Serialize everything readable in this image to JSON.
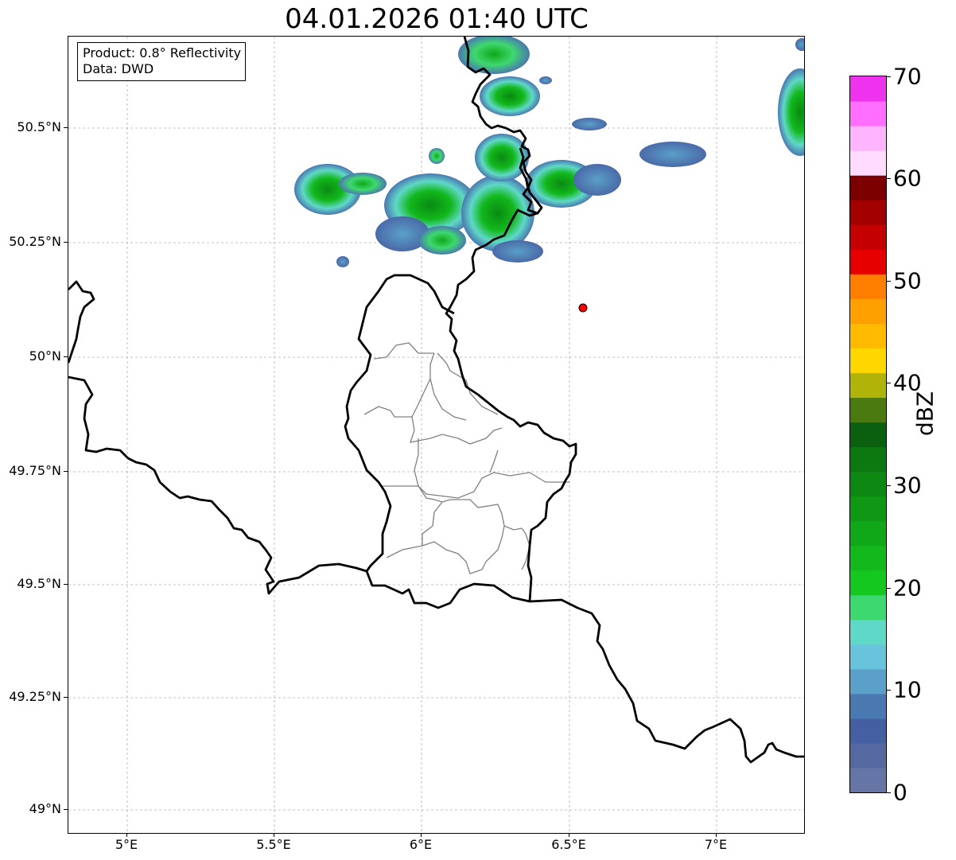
{
  "title": "04.01.2026 01:40 UTC",
  "info": {
    "product": "Product: 0.8° Reflectivity",
    "data": "Data: DWD"
  },
  "map": {
    "lon_range": [
      4.8,
      7.3
    ],
    "lat_range": [
      48.95,
      50.695
    ],
    "lon_ticks": [
      {
        "v": 5.0,
        "label": "5°E"
      },
      {
        "v": 5.5,
        "label": "5.5°E"
      },
      {
        "v": 6.0,
        "label": "6°E"
      },
      {
        "v": 6.5,
        "label": "6.5°E"
      },
      {
        "v": 7.0,
        "label": "7°E"
      }
    ],
    "lat_ticks": [
      {
        "v": 49.0,
        "label": "49°N"
      },
      {
        "v": 49.25,
        "label": "49.25°N"
      },
      {
        "v": 49.5,
        "label": "49.5°N"
      },
      {
        "v": 49.75,
        "label": "49.75°N"
      },
      {
        "v": 50.0,
        "label": "50°N"
      },
      {
        "v": 50.25,
        "label": "50.25°N"
      },
      {
        "v": 50.5,
        "label": "50.5°N"
      }
    ],
    "gridlines": true,
    "radar_site": {
      "lon": 6.548,
      "lat": 50.11,
      "color": "#ff0000"
    }
  },
  "colorbar": {
    "label": "dBZ",
    "min": 0,
    "max": 70,
    "tick_labels": [
      "0",
      "10",
      "20",
      "30",
      "40",
      "50",
      "60",
      "70"
    ],
    "colors": [
      "#6575a6",
      "#5569a0",
      "#4460a2",
      "#4a78b0",
      "#5aa0c8",
      "#68c4dd",
      "#60d8c8",
      "#3ed870",
      "#14c820",
      "#12b81c",
      "#10a818",
      "#0e9814",
      "#0d8812",
      "#0c7810",
      "#0a600e",
      "#4a7a10",
      "#b0b408",
      "#ffd700",
      "#ffba00",
      "#ff9f00",
      "#ff7e00",
      "#e60000",
      "#c40000",
      "#a30000",
      "#7d0000",
      "#ffdcff",
      "#ffb4ff",
      "#ff6eff",
      "#ee33ee"
    ]
  },
  "colors": {
    "country_border": "#000000",
    "admin_border": "#808080",
    "grid": "#b0b0b0"
  }
}
